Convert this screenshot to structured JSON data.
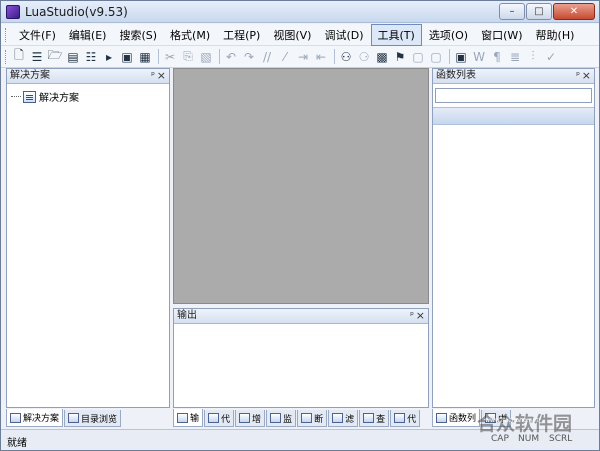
{
  "window": {
    "title": "LuaStudio(v9.53)"
  },
  "menubar": {
    "items": [
      "文件(F)",
      "编辑(E)",
      "搜索(S)",
      "格式(M)",
      "工程(P)",
      "视图(V)",
      "调试(D)",
      "工具(T)",
      "选项(O)",
      "窗口(W)",
      "帮助(H)"
    ],
    "active_index": 7
  },
  "toolbar": {
    "icons": [
      "new-file-icon",
      "new-project-icon",
      "open-folder-icon",
      "open-icon",
      "build-icon",
      "run-icon",
      "save-icon",
      "save-all-icon",
      "cut-icon",
      "copy-icon",
      "paste-icon",
      "undo-icon",
      "redo-icon",
      "comment-icon",
      "uncomment-icon",
      "indent-icon",
      "outdent-icon",
      "find-icon",
      "find-next-icon",
      "replace-icon",
      "bookmark-icon",
      "prev-bookmark-icon",
      "next-bookmark-icon",
      "view-icon",
      "word-wrap-icon",
      "pilcrow-icon",
      "format-icon",
      "compare-icon",
      "check-icon"
    ]
  },
  "solution_panel": {
    "title": "解决方案",
    "pin": "ᵖ",
    "tree_root": "解决方案"
  },
  "output_panel": {
    "title": "输出",
    "pin": "ᵖ"
  },
  "function_panel": {
    "title": "函数列表",
    "pin": "ᵖ",
    "search_value": ""
  },
  "left_tabs": [
    "解决方案",
    "目录浏览"
  ],
  "mid_tabs": [
    "输",
    "代",
    "增",
    "监",
    "断",
    "滤",
    "查",
    "代"
  ],
  "right_tabs": [
    "函数列",
    "中"
  ],
  "close_glyph": "×",
  "statusbar": {
    "text": "就绪",
    "indicators": [
      "CAP",
      "NUM",
      "SCRL"
    ]
  },
  "watermark": {
    "text": "合众软件园",
    "url": "www.hezhong.net"
  }
}
